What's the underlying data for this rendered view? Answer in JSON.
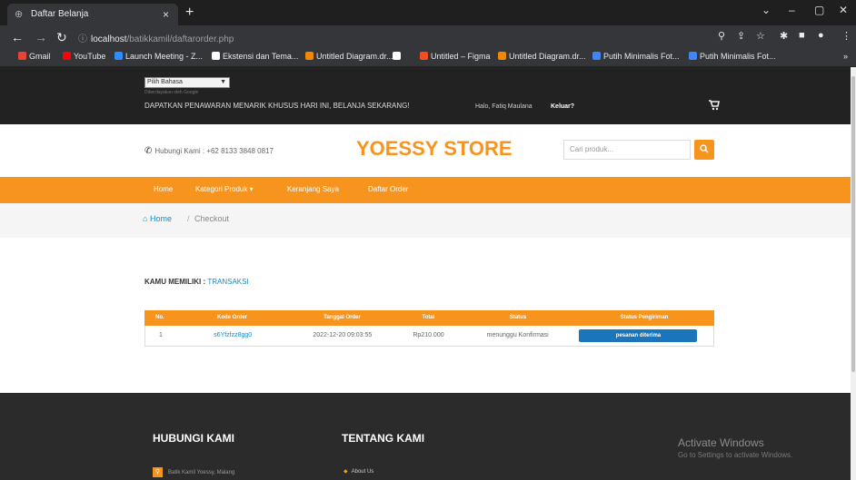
{
  "browser": {
    "tab_title": "Daftar Belanja",
    "url_host": "localhost",
    "url_path": "/batikkamil/daftarorder.php",
    "bookmarks": [
      {
        "label": "Gmail",
        "color": "#ea4335"
      },
      {
        "label": "YouTube",
        "color": "#ff0000"
      },
      {
        "label": "Launch Meeting - Z...",
        "color": "#2d8cff"
      },
      {
        "label": "Ekstensi dan Tema...",
        "color": "#ffffff"
      },
      {
        "label": "Untitled Diagram.dr...",
        "color": "#f08705"
      },
      {
        "label": "",
        "color": "#ffffff"
      },
      {
        "label": "Untitled – Figma",
        "color": "#f24e1e"
      },
      {
        "label": "Untitled Diagram.dr...",
        "color": "#f08705"
      },
      {
        "label": "Putih Minimalis Fot...",
        "color": "#4285f4"
      },
      {
        "label": "Putih Minimalis Fot...",
        "color": "#4285f4"
      }
    ]
  },
  "topbar": {
    "language_select": "Pilih Bahasa",
    "powered_by": "Diberdayakan oleh Google",
    "promo": "DAPATKAN PENAWARAN MENARIK KHUSUS HARI INI, BELANJA SEKARANG!",
    "greeting": "Halo, Fatiq Maulana",
    "logout": "Keluar?"
  },
  "header": {
    "phone": "Hubungi Kami : +62 8133 3848 0817",
    "store_name": "YOESSY STORE",
    "search_placeholder": "Cari produk..."
  },
  "menu": {
    "items": [
      "Home",
      "Kategori Produk",
      "Keranjang Saya",
      "Daftar Order"
    ]
  },
  "breadcrumb": {
    "home": "Home",
    "separator": "/",
    "current": "Checkout"
  },
  "orders": {
    "heading": "KAMU MEMILIKI : ",
    "heading_highlight": "TRANSAKSI",
    "columns": [
      "No.",
      "Kode Order",
      "Tanggal Order",
      "Total",
      "Status",
      "Status Pengiriman"
    ],
    "rows": [
      {
        "no": "1",
        "code": "s6Yfzfzz8gg0",
        "date": "2022-12-20 09:03:55",
        "total": "Rp210.000",
        "status": "menunggu Konfirmasi",
        "shipping": "pesanan diterima"
      }
    ]
  },
  "footer": {
    "contact_title": "HUBUNGI KAMI",
    "about_title": "TENTANG KAMI",
    "address": "Batik Kamil Yoessy, Malang",
    "about_link": "About Us"
  },
  "watermark": {
    "title": "Activate Windows",
    "subtitle": "Go to Settings to activate Windows."
  },
  "colors": {
    "accent": "#f7941e",
    "link": "#1a8bc0",
    "button": "#1a75bb"
  }
}
